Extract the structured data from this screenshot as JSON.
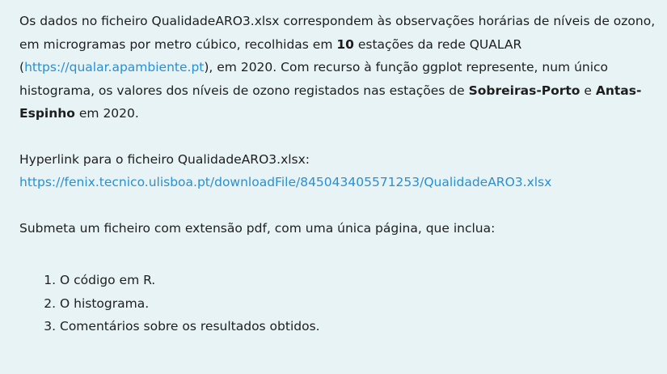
{
  "intro": {
    "t1": "Os dados no ficheiro QualidadeARO3.xlsx correspondem às observações horárias de níveis de ozono, em microgramas por metro cúbico, recolhidas em ",
    "count": "10",
    "t2": " estações da rede QUALAR (",
    "qualar_link": "https://qualar.apambiente.pt",
    "t3": "), em 2020. Com recurso à função ggplot represente, num único histograma, os valores dos níveis de ozono registados nas estações de ",
    "station1": "Sobreiras-Porto",
    "t4": " e ",
    "station2": "Antas-Espinho",
    "t5": " em 2020."
  },
  "hyperlink": {
    "label": "Hyperlink para o ficheiro QualidadeARO3.xlsx:",
    "url": "https://fenix.tecnico.ulisboa.pt/downloadFile/845043405571253/QualidadeARO3.xlsx"
  },
  "submit_text": "Submeta um ficheiro com extensão pdf, com uma única página, que inclua:",
  "items": [
    "O código em R.",
    "O histograma.",
    "Comentários sobre os resultados obtidos."
  ]
}
